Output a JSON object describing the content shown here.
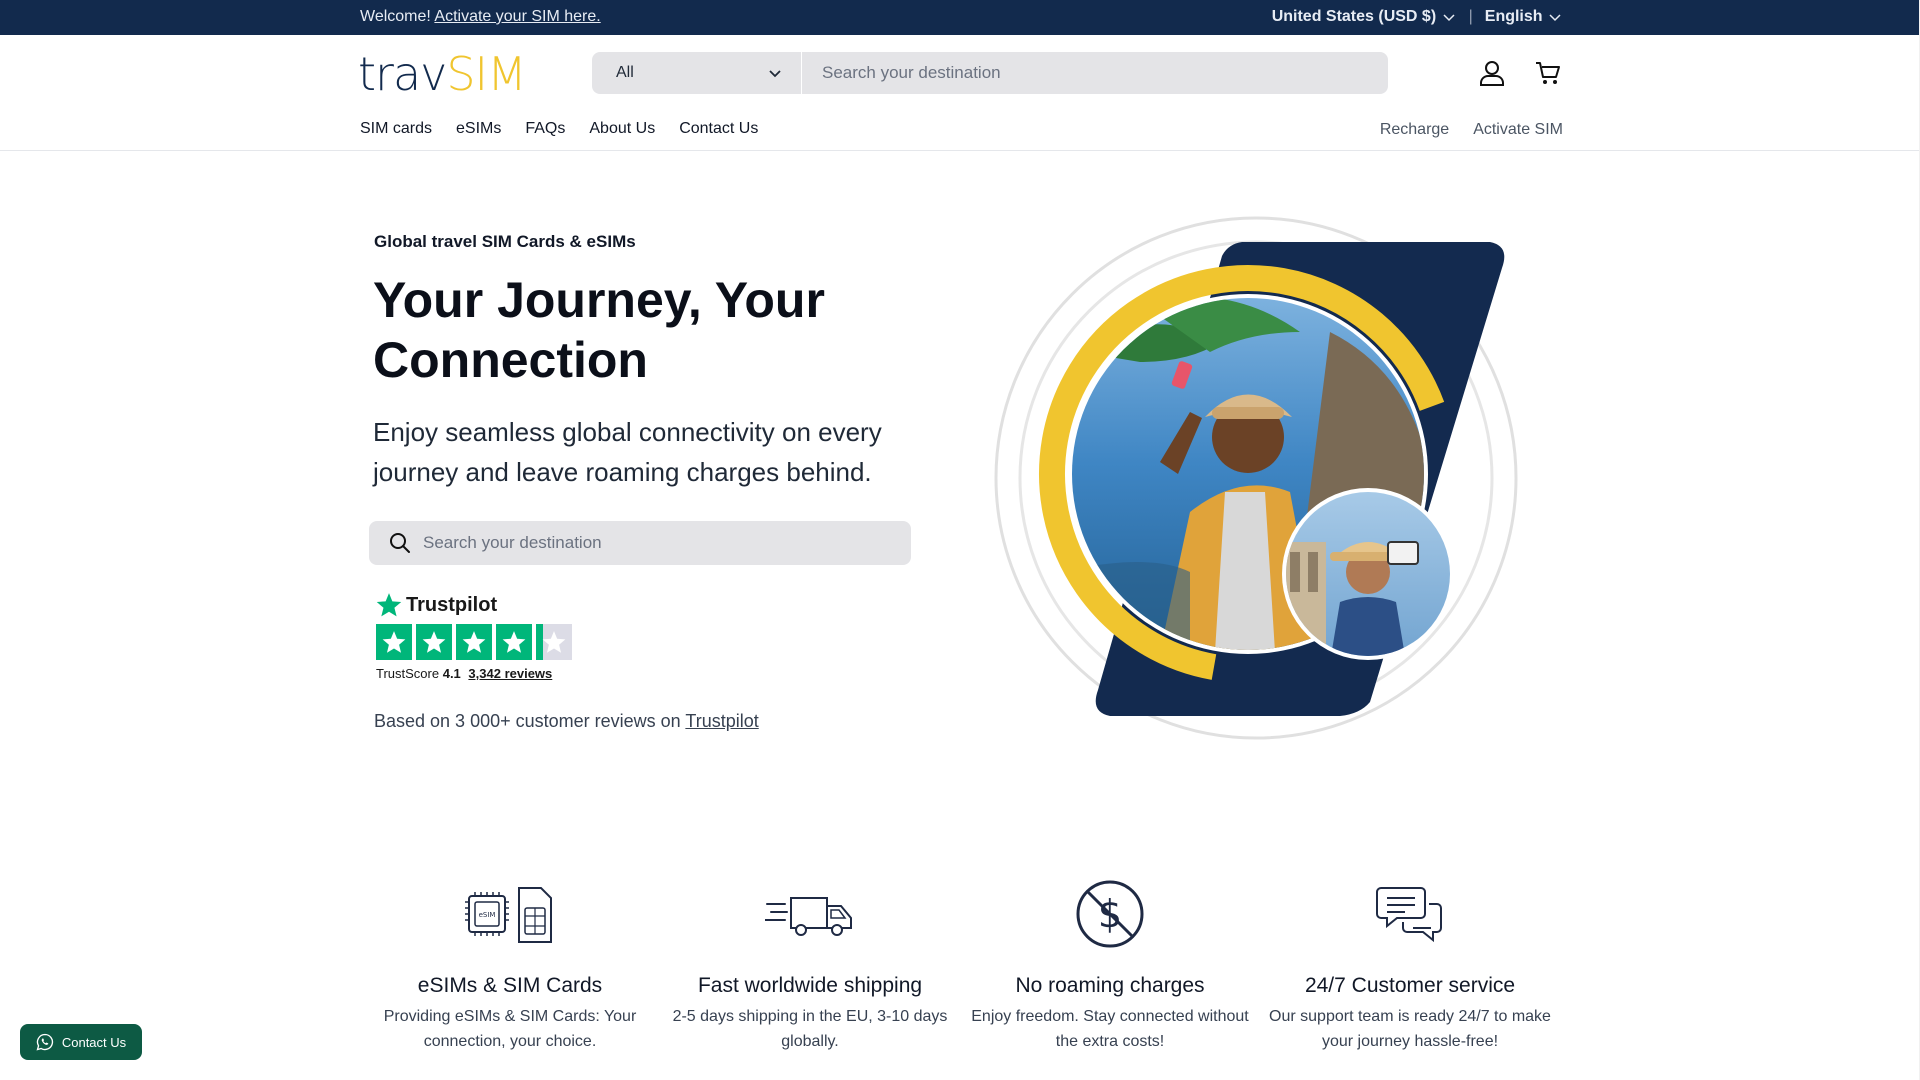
{
  "topbar": {
    "welcome": "Welcome!",
    "activate_link": "Activate your SIM here.",
    "currency": "United States (USD $)",
    "separator": "|",
    "language": "English"
  },
  "header": {
    "logo_part1": "trav",
    "logo_part2": "SIM",
    "search_category": "All",
    "search_placeholder": "Search your destination",
    "nav": [
      "SIM cards",
      "eSIMs",
      "FAQs",
      "About Us",
      "Contact Us"
    ],
    "nav_right": [
      "Recharge",
      "Activate SIM"
    ]
  },
  "hero": {
    "eyebrow": "Global travel SIM Cards & eSIMs",
    "title": "Your Journey, Your Connection",
    "subtitle": "Enjoy seamless global connectivity on every journey and leave roaming charges behind.",
    "search_placeholder": "Search your destination",
    "trustpilot": {
      "brand": "Trustpilot",
      "stars": 4.1,
      "score_label": "TrustScore",
      "score": "4.1",
      "reviews": "3,342 reviews"
    },
    "based_on": "Based on 3 000+ customer reviews on",
    "based_on_link": "Trustpilot"
  },
  "features": [
    {
      "icon": "esim-simcard-icon",
      "title": "eSIMs & SIM Cards",
      "desc": "Providing eSIMs & SIM Cards: Your connection, your choice."
    },
    {
      "icon": "delivery-truck-icon",
      "title": "Fast worldwide shipping",
      "desc": "2-5 days shipping in the EU, 3-10 days globally."
    },
    {
      "icon": "no-dollar-icon",
      "title": "No roaming charges",
      "desc": "Enjoy freedom. Stay connected without the extra costs!"
    },
    {
      "icon": "chat-bubbles-icon",
      "title": "24/7 Customer service",
      "desc": "Our support team is ready 24/7 to make your journey hassle-free!"
    }
  ],
  "float_contact": {
    "label": "Contact Us"
  },
  "colors": {
    "navy": "#122a4d",
    "yellow": "#f0c52f",
    "trustpilot_green": "#00b67a",
    "contact_green": "#0d5a44"
  }
}
